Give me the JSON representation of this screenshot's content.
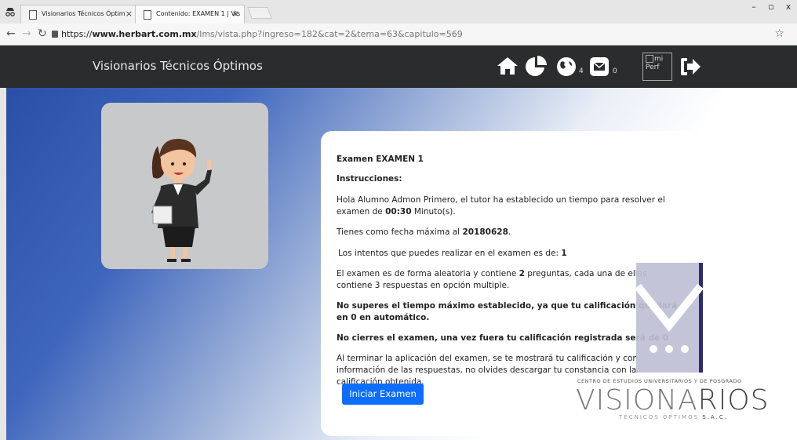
{
  "browser": {
    "tabs": [
      {
        "title": "Visionarios Técnicos Óptim",
        "active": false
      },
      {
        "title": "Contenido: EXAMEN 1 | Vis",
        "active": true
      }
    ],
    "window_buttons": [
      "–",
      "▫",
      "x"
    ],
    "url_scheme": "https://",
    "url_host": "www.herbart.com.mx",
    "url_path": "/lms/vista.php?ingreso=182&cat=2&tema=63&capitulo=569"
  },
  "header": {
    "brand": "Visionarios Técnicos Óptimos",
    "icons": [
      "home-icon",
      "pie-chart-icon",
      "globe-icon",
      "envelope-icon",
      "sign-out-icon"
    ],
    "globe_count": "4",
    "mail_count": "0",
    "profile_alt": "mi Perf"
  },
  "exam": {
    "title": "Examen EXAMEN 1",
    "instructions_label": "Instrucciones:",
    "p1": "Hola Alumno Admon Primero, el tutor ha establecido un tiempo para resolver el examen de",
    "p1_time": "00:30",
    "p1_end": "Minuto(s).",
    "p2": "Tienes como fecha máxima al",
    "p2_date": "20180628",
    "p3": "Los intentos que puedes realizar en el examen es de:",
    "p3_attempts": "1",
    "p4_a": "El examen es de forma aleatoria y contiene",
    "p4_count": "2",
    "p4_b": "preguntas, cada una de ellas contiene 3 respuestas en opción multiple.",
    "warning1": "No superes el tiempo máximo establecido, ya que tu calificación quedará en 0 en automático.",
    "warning2": "No cierres el examen, una vez fuera tu calificación registrada será de 0",
    "p5": "Al terminar la aplicación del examen, se te mostrará tu calificación y con información de las respuestas, no olvides descargar tu constancia con la calificación obtenida.",
    "start_button": "Iniciar Examen"
  },
  "logo": {
    "subtitle": "CENTRO DE ESTUDIOS UNIVERSITARIOS Y DE POSGRADO",
    "name_light": "VISIONA",
    "name_dark": "RIOS",
    "foot_light": "TÉCNICOS ÓPTIMOS",
    "foot_dark": " S.A.C."
  },
  "colors": {
    "header_bg": "#2a2c2e",
    "button_blue": "#0d6efd",
    "gradient_blue": "#2a4fa7"
  }
}
